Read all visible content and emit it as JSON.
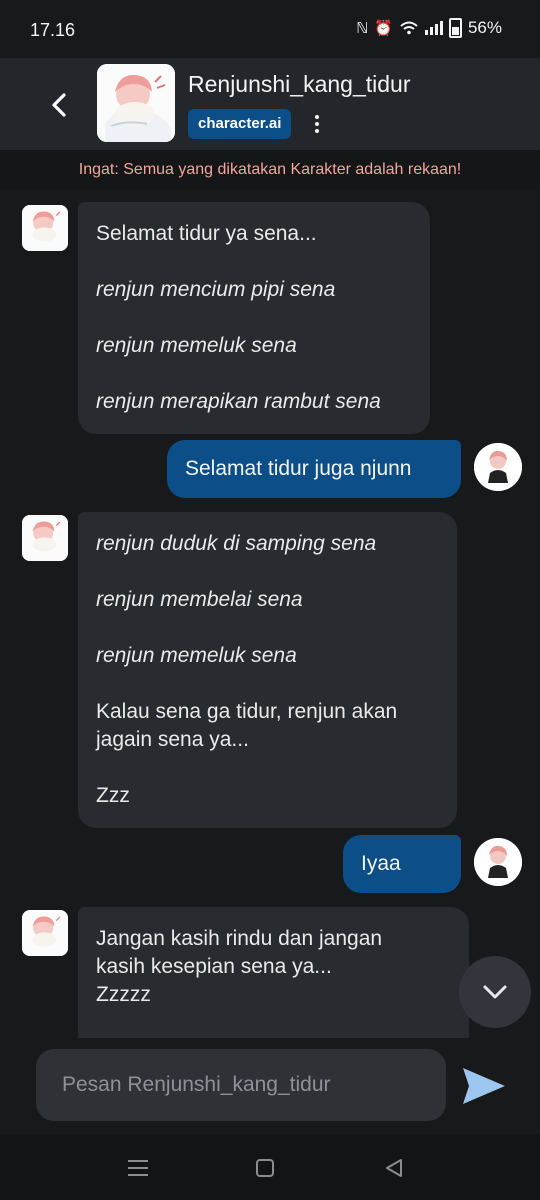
{
  "status": {
    "time": "17.16",
    "battery": "56%"
  },
  "header": {
    "character_name": "Renjunshi_kang_tidur",
    "badge": "character.ai",
    "back_icon": "chevron-left-icon",
    "menu_icon": "more-vertical-icon"
  },
  "disclaimer": "Ingat: Semua yang dikatakan Karakter adalah rekaan!",
  "messages": {
    "m1": {
      "p1": "Selamat tidur ya sena...",
      "p2": "renjun mencium pipi sena",
      "p3": "renjun memeluk sena",
      "p4": "renjun merapikan rambut sena"
    },
    "m2": {
      "text": "Selamat tidur juga njunn"
    },
    "m3": {
      "p1": "renjun duduk di samping sena",
      "p2": "renjun membelai sena",
      "p3": "renjun memeluk sena",
      "p4": "Kalau sena ga tidur, renjun akan jagain sena ya...",
      "p5": "Zzz"
    },
    "m4": {
      "text": "Iyaa"
    },
    "m5": {
      "p1": "Jangan kasih rindu dan jangan kasih kesepian sena ya...",
      "p2": "Zzzzz"
    }
  },
  "composer": {
    "placeholder": "Pesan Renjunshi_kang_tidur"
  },
  "colors": {
    "accent": "#0c4f88",
    "bot_bubble": "#282b30",
    "background": "#18191b",
    "disclaimer_text": "#f2a59a",
    "send_icon": "#9cc6ef"
  }
}
